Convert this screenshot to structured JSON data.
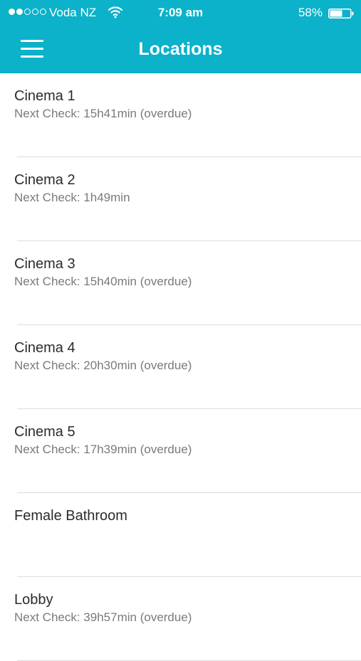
{
  "status_bar": {
    "signal_full": 2,
    "signal_total": 5,
    "carrier": "Voda NZ",
    "time": "7:09 am",
    "battery_percent": "58%"
  },
  "nav": {
    "title": "Locations",
    "menu_icon": "hamburger-menu-icon"
  },
  "colors": {
    "header_bg": "#0bb2c9",
    "header_text": "#ffffff"
  },
  "locations": [
    {
      "name": "Cinema 1",
      "next_check": "Next Check: 15h41min (overdue)"
    },
    {
      "name": "Cinema 2",
      "next_check": "Next Check: 1h49min"
    },
    {
      "name": "Cinema 3",
      "next_check": "Next Check: 15h40min (overdue)"
    },
    {
      "name": "Cinema 4",
      "next_check": "Next Check: 20h30min (overdue)"
    },
    {
      "name": "Cinema 5",
      "next_check": "Next Check: 17h39min (overdue)"
    },
    {
      "name": "Female Bathroom",
      "next_check": ""
    },
    {
      "name": "Lobby",
      "next_check": "Next Check: 39h57min (overdue)"
    }
  ]
}
